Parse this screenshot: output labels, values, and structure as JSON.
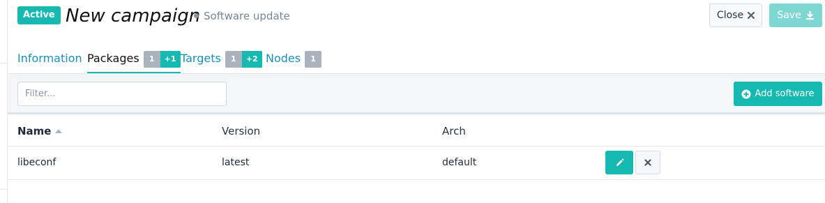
{
  "header": {
    "status_badge": "Active",
    "title": "New campaign",
    "subtitle": "Software update",
    "close_label": "Close",
    "save_label": "Save",
    "close_icon": "x-icon",
    "save_icon": "download-icon"
  },
  "tabs": [
    {
      "label": "Information",
      "active": false
    },
    {
      "label": "Packages",
      "active": true,
      "count": "1",
      "added": "+1"
    },
    {
      "label": "Targets",
      "active": false,
      "count": "1",
      "added": "+2"
    },
    {
      "label": "Nodes",
      "active": false,
      "count": "1"
    }
  ],
  "toolbar": {
    "filter_placeholder": "Filter...",
    "filter_value": "",
    "add_label": "Add software",
    "add_icon": "plus-circle-icon"
  },
  "table": {
    "columns": [
      "Name",
      "Version",
      "Arch"
    ],
    "sort_column": "Name",
    "sort_direction": "ascending",
    "rows": [
      {
        "name": "libeconf",
        "version": "latest",
        "arch": "default"
      }
    ]
  },
  "colors": {
    "accent": "#16b8b2",
    "link": "#1a8fb5",
    "count_badge": "#aab3bd"
  }
}
